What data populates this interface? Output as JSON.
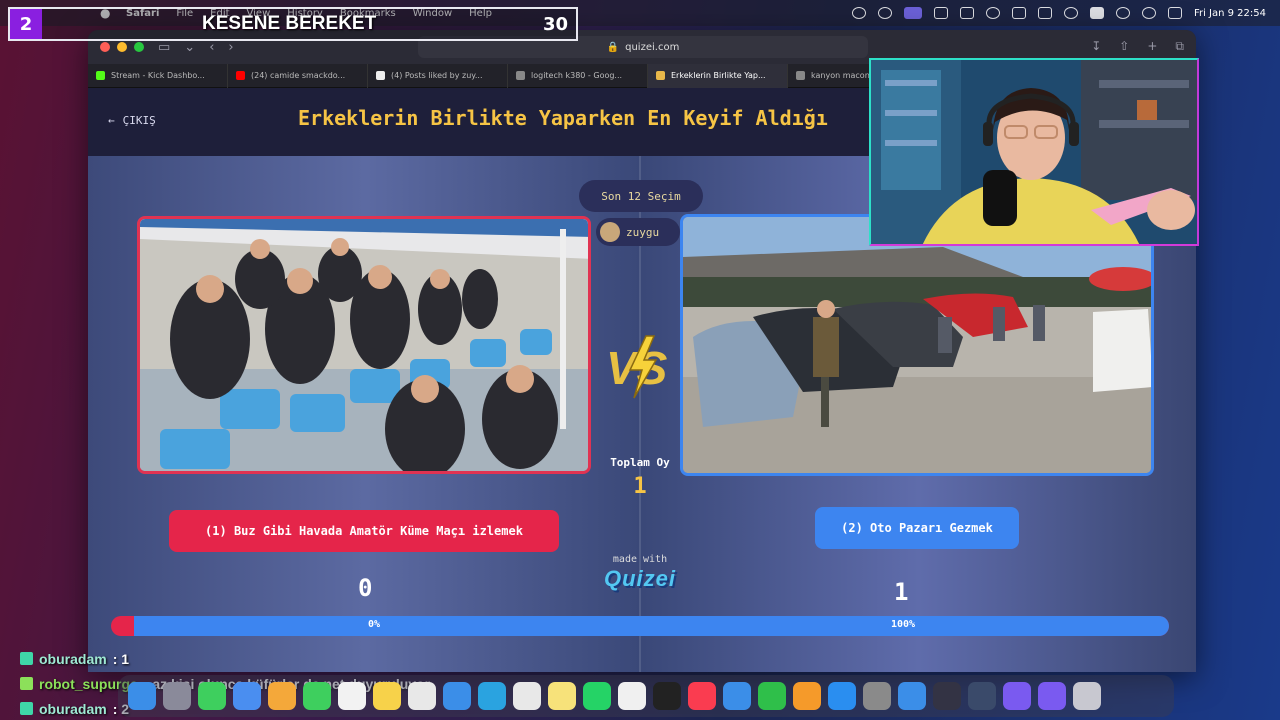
{
  "menubar": {
    "app": "Safari",
    "items": [
      "File",
      "Edit",
      "View",
      "History",
      "Bookmarks",
      "Window",
      "Help"
    ],
    "clock": "Fri Jan 9  22:54"
  },
  "overlay": {
    "counter": "2",
    "title": "KESENE BEREKET",
    "right_value": "30"
  },
  "browser": {
    "url": "quizei.com",
    "tabs": [
      {
        "label": "Stream - Kick Dashbo...",
        "color": "#53fc18"
      },
      {
        "label": "(24) camide smackdo...",
        "color": "#ff0000"
      },
      {
        "label": "(4) Posts liked by zuy...",
        "color": "#111111"
      },
      {
        "label": "logitech k380 - Goog...",
        "color": "#666666"
      },
      {
        "label": "Erkeklerin Birlikte Yap...",
        "color": "#e8b84a"
      },
      {
        "label": "kanyon macon",
        "color": "#666666"
      }
    ]
  },
  "quiz": {
    "back_label": "ÇIKIŞ",
    "title": "Erkeklerin Birlikte Yaparken En Keyif Aldığı",
    "round_label": "Son 12 Seçim",
    "username": "zuygu",
    "total_label": "Toplam Oy",
    "total_value": "1",
    "option_left": "(1) Buz Gibi Havada Amatör Küme Maçı izlemek",
    "option_right": "(2) Oto Pazarı Gezmek",
    "score_left": "0",
    "score_right": "1",
    "made_with": "made with",
    "brand": "Quizei",
    "pct_left": "0%",
    "pct_right": "100%",
    "fraction_right": 1.0
  },
  "chat": [
    {
      "user": "oburadam",
      "message": ": 1"
    },
    {
      "user": "robot_supurge",
      "message": ": az kişi olunca küfürler de net duyuruluyor"
    },
    {
      "user": "oburadam",
      "message": ": 2"
    }
  ],
  "dock": {
    "icons": [
      "finder-icon",
      "launchpad-icon",
      "messages-icon",
      "mail-icon",
      "photos-icon",
      "facetime-icon",
      "calendar-icon",
      "notes-icon",
      "reminders-icon",
      "safari-icon",
      "telegram-icon",
      "chrome-icon",
      "stickies-icon",
      "whatsapp-icon",
      "freeform-icon",
      "appletv-icon",
      "music-icon",
      "keynote-icon",
      "numbers-icon",
      "pages-icon",
      "appstore-icon",
      "settings-icon",
      "xcode-icon",
      "obs-icon",
      "quicktime-icon",
      "streamdeck-icon",
      "streamdeck2-icon",
      "trash-icon"
    ]
  }
}
